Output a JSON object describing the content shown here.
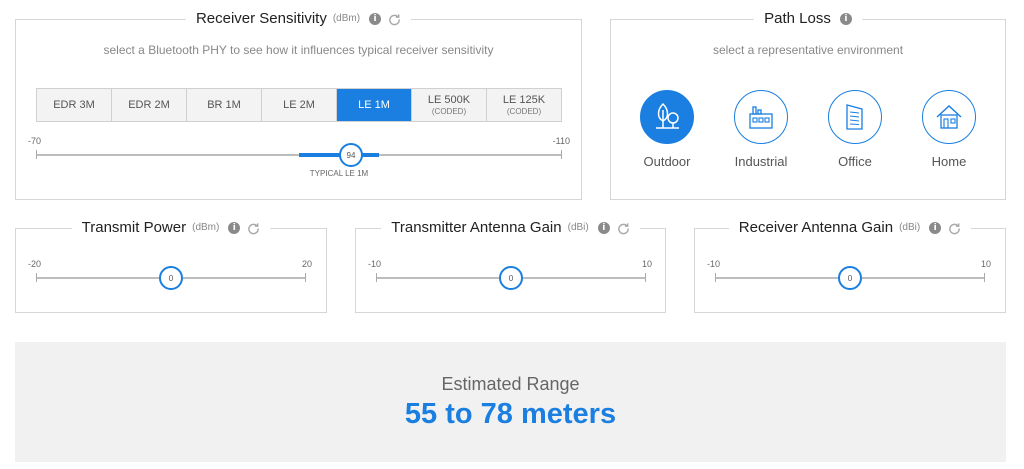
{
  "receiver_sensitivity": {
    "title": "Receiver Sensitivity",
    "unit": "(dBm)",
    "subtitle": "select a Bluetooth PHY to see how it influences typical receiver sensitivity",
    "tabs": [
      {
        "label": "EDR 3M",
        "sub": ""
      },
      {
        "label": "EDR 2M",
        "sub": ""
      },
      {
        "label": "BR 1M",
        "sub": ""
      },
      {
        "label": "LE 2M",
        "sub": ""
      },
      {
        "label": "LE 1M",
        "sub": ""
      },
      {
        "label": "LE 500K",
        "sub": "(CODED)"
      },
      {
        "label": "LE 125K",
        "sub": "(CODED)"
      }
    ],
    "active_tab": "LE 1M",
    "slider": {
      "min": "-70",
      "max": "-110",
      "value": "94",
      "typical_label": "TYPICAL LE 1M"
    }
  },
  "path_loss": {
    "title": "Path Loss",
    "subtitle": "select a representative environment",
    "environments": [
      {
        "label": "Outdoor",
        "icon": "tree-icon",
        "active": true
      },
      {
        "label": "Industrial",
        "icon": "factory-icon",
        "active": false
      },
      {
        "label": "Office",
        "icon": "office-building-icon",
        "active": false
      },
      {
        "label": "Home",
        "icon": "house-icon",
        "active": false
      }
    ]
  },
  "transmit_power": {
    "title": "Transmit Power",
    "unit": "(dBm)",
    "slider": {
      "min": "-20",
      "max": "20",
      "value": "0"
    }
  },
  "tx_antenna_gain": {
    "title": "Transmitter Antenna Gain",
    "unit": "(dBi)",
    "slider": {
      "min": "-10",
      "max": "10",
      "value": "0"
    }
  },
  "rx_antenna_gain": {
    "title": "Receiver Antenna Gain",
    "unit": "(dBi)",
    "slider": {
      "min": "-10",
      "max": "10",
      "value": "0"
    }
  },
  "estimated_range": {
    "label": "Estimated Range",
    "value": "55 to 78 meters"
  },
  "colors": {
    "accent": "#1a7fe0",
    "border": "#d6d6d6",
    "range_bg": "#f1f1f1"
  }
}
